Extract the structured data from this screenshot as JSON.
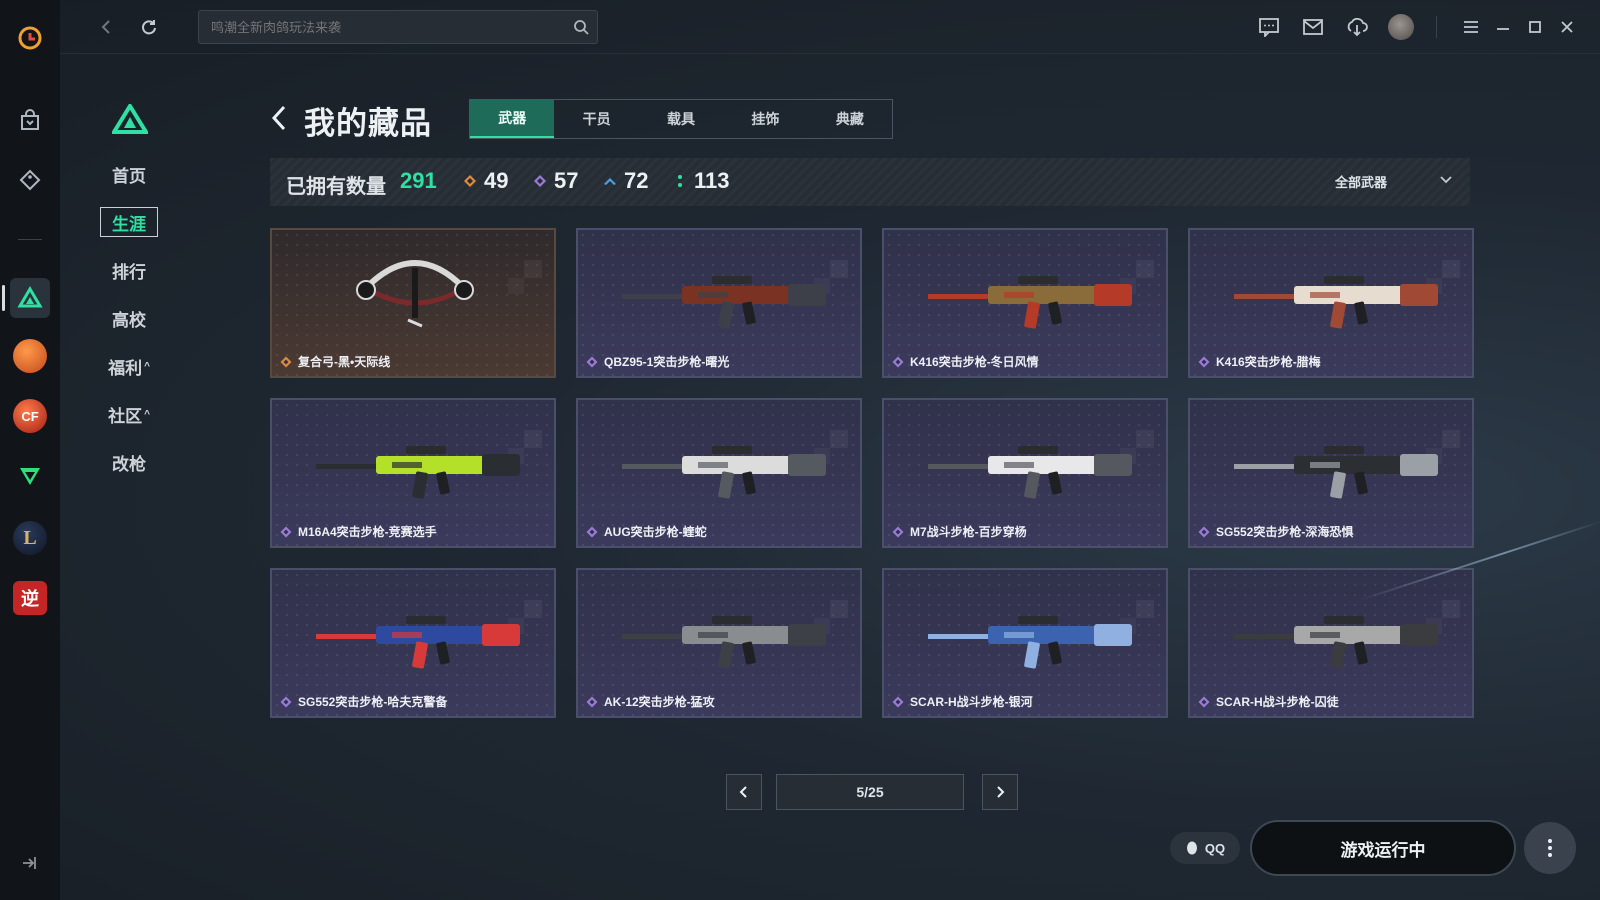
{
  "search": {
    "placeholder": "鸣潮全新肉鸽玩法来袭"
  },
  "sidenav": {
    "items": [
      {
        "label": "首页",
        "active": false
      },
      {
        "label": "生涯",
        "active": true
      },
      {
        "label": "排行",
        "active": false
      },
      {
        "label": "高校",
        "active": false
      },
      {
        "label": "福利",
        "caret": "^",
        "active": false
      },
      {
        "label": "社区",
        "caret": "^",
        "active": false
      },
      {
        "label": "改枪",
        "active": false
      }
    ]
  },
  "rail": {
    "games": [
      {
        "name": "basketball-game-icon",
        "color": "#e0672a"
      },
      {
        "name": "crossfire-game-icon",
        "color": "#c7301f"
      },
      {
        "name": "valorant-style-game-icon",
        "color": "#2ee07a"
      },
      {
        "name": "league-game-icon",
        "color": "#c8a85a"
      },
      {
        "name": "ni-game-icon",
        "glyph": "逆",
        "color": "#d42f2f"
      }
    ]
  },
  "page": {
    "title": "我的藏品"
  },
  "tabs": [
    {
      "label": "武器",
      "active": true
    },
    {
      "label": "干员",
      "active": false
    },
    {
      "label": "载具",
      "active": false
    },
    {
      "label": "挂饰",
      "active": false
    },
    {
      "label": "典藏",
      "active": false
    }
  ],
  "stats": {
    "owned_label": "已拥有数量",
    "owned_count": "291",
    "rarities": [
      {
        "icon": "orange-diamond-icon",
        "color": "#e08a3c",
        "count": "49"
      },
      {
        "icon": "purple-diamond-icon",
        "color": "#9b7bd8",
        "count": "57"
      },
      {
        "icon": "blue-chevron-icon",
        "color": "#4aa3e8",
        "count": "72"
      },
      {
        "icon": "green-dots-icon",
        "color": "#2ee0a2",
        "count": "113"
      }
    ],
    "filter_label": "全部武器"
  },
  "cards": [
    {
      "name": "复合弓-黑•天际线",
      "rarity": "gold"
    },
    {
      "name": "QBZ95-1突击步枪-曙光",
      "rarity": "purple"
    },
    {
      "name": "K416突击步枪-冬日风情",
      "rarity": "purple"
    },
    {
      "name": "K416突击步枪-腊梅",
      "rarity": "purple"
    },
    {
      "name": "M16A4突击步枪-竞赛选手",
      "rarity": "purple"
    },
    {
      "name": "AUG突击步枪-蝰蛇",
      "rarity": "purple"
    },
    {
      "name": "M7战斗步枪-百步穿杨",
      "rarity": "purple"
    },
    {
      "name": "SG552突击步枪-深海恐惧",
      "rarity": "purple"
    },
    {
      "name": "SG552突击步枪-哈夫克警备",
      "rarity": "purple"
    },
    {
      "name": "AK-12突击步枪-猛攻",
      "rarity": "purple"
    },
    {
      "name": "SCAR-H战斗步枪-银河",
      "rarity": "purple"
    },
    {
      "name": "SCAR-H战斗步枪-囚徒",
      "rarity": "purple"
    }
  ],
  "pager": {
    "current": 5,
    "total": 25,
    "text": "5/25"
  },
  "bottom": {
    "qq_label": "QQ",
    "launch_label": "游戏运行中"
  },
  "colors": {
    "accent": "#2ee0a2",
    "purple_border": "#4a4f6a",
    "gold_border": "#5a4a3e"
  }
}
